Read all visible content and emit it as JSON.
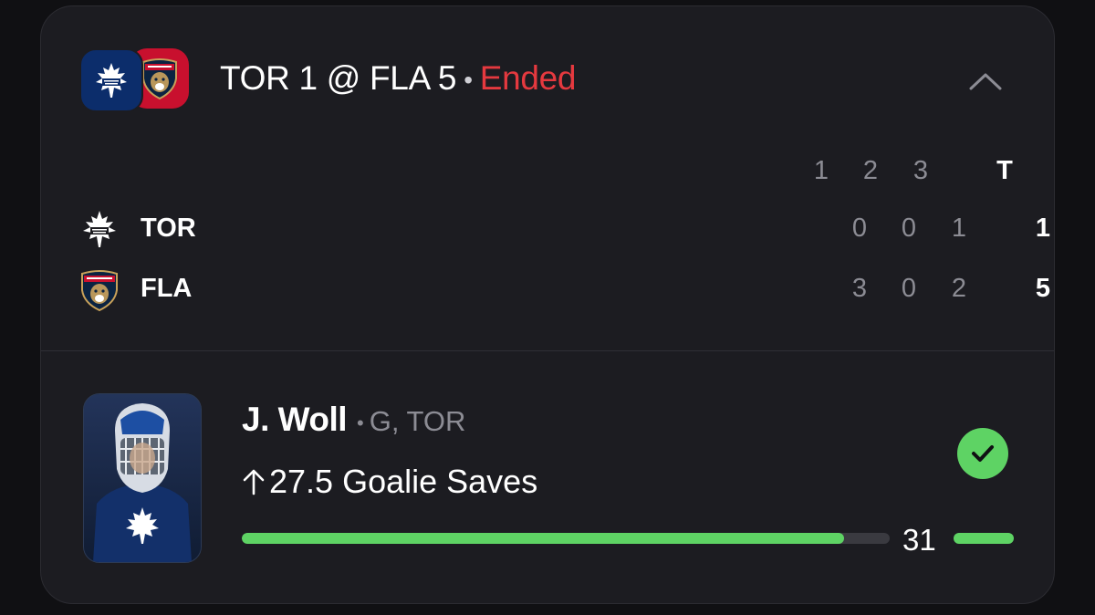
{
  "game": {
    "home_logo": "panthers-logo",
    "away_logo": "maple-leafs-logo",
    "summary": "TOR 1 @ FLA 5",
    "separator": "•",
    "status": "Ended",
    "status_color": "#e5393f",
    "collapse_icon": "chevron-up-icon"
  },
  "boxscore": {
    "headers": [
      "1",
      "2",
      "3",
      "T"
    ],
    "teams": [
      {
        "abbr": "TOR",
        "logo": "maple-leafs-logo",
        "periods": [
          "0",
          "0",
          "1"
        ],
        "total": "1"
      },
      {
        "abbr": "FLA",
        "logo": "panthers-logo",
        "periods": [
          "3",
          "0",
          "2"
        ],
        "total": "5"
      }
    ]
  },
  "prop": {
    "player_name": "J. Woll",
    "separator": "•",
    "position_team": "G, TOR",
    "direction_icon": "arrow-up-icon",
    "line": "27.5 Goalie Saves",
    "result": "31",
    "result_icon": "check-circle-icon",
    "progress_fraction": 0.93,
    "accent_color": "#5ed364"
  }
}
